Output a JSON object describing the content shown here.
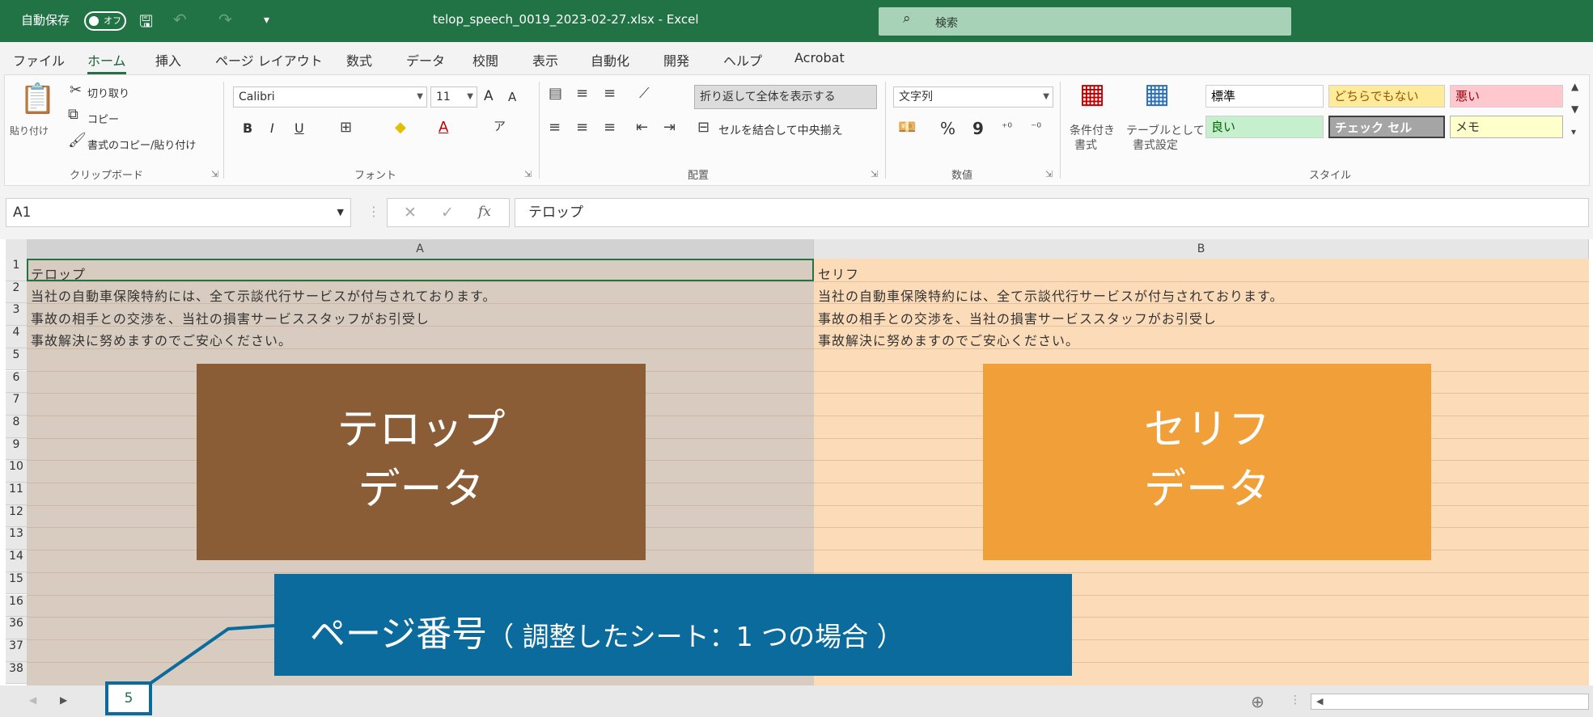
{
  "titlebar": {
    "autosave_label": "自動保存",
    "autosave_state": "オフ",
    "title": "telop_speech_0019_2023-02-27.xlsx  -  Excel",
    "search_placeholder": "検索"
  },
  "menu": {
    "tabs": [
      "ファイル",
      "ホーム",
      "挿入",
      "ページ レイアウト",
      "数式",
      "データ",
      "校閲",
      "表示",
      "自動化",
      "開発",
      "ヘルプ",
      "Acrobat"
    ],
    "active": "ホーム"
  },
  "ribbon": {
    "clipboard": {
      "paste": "貼り付け",
      "cut": "切り取り",
      "copy": "コピー",
      "format_painter": "書式のコピー/貼り付け",
      "label": "クリップボード"
    },
    "font": {
      "name": "Calibri",
      "size": "11",
      "grow": "A",
      "shrink": "A",
      "bold": "B",
      "italic": "I",
      "underline": "U",
      "font_color": "A",
      "label": "フォント"
    },
    "alignment": {
      "wrap_text": "折り返して全体を表示する",
      "merge_center": "セルを結合して中央揃え",
      "label": "配置"
    },
    "number": {
      "format": "文字列",
      "percent": "%",
      "comma": "9",
      "label": "数値"
    },
    "styles": {
      "conditional": "条件付き",
      "conditional2": "書式",
      "as_table": "テーブルとして",
      "as_table2": "書式設定",
      "label": "スタイル",
      "cells": {
        "normal": "標準",
        "neutral": "どちらでもない",
        "bad": "悪い",
        "good": "良い",
        "check": "チェック セル",
        "note": "メモ"
      }
    }
  },
  "formula_bar": {
    "name_box": "A1",
    "fx": "fx",
    "cancel": "✕",
    "enter": "✓",
    "content": "テロップ"
  },
  "sheet": {
    "columns": [
      "A",
      "B"
    ],
    "row_numbers": [
      "1",
      "2",
      "3",
      "4",
      "5",
      "6",
      "7",
      "8",
      "9",
      "10",
      "11",
      "12",
      "13",
      "14",
      "15",
      "16",
      "36",
      "37",
      "38"
    ],
    "rows": [
      {
        "a": "テロップ",
        "b": "セリフ"
      },
      {
        "a": "当社の自動車保険特約には、全て示談代行サービスが付与されております。",
        "b": "当社の自動車保険特約には、全て示談代行サービスが付与されております。"
      },
      {
        "a": "事故の相手との交渉を、当社の損害サービススタッフがお引受し",
        "b": "事故の相手との交渉を、当社の損害サービススタッフがお引受し"
      },
      {
        "a": "事故解決に努めますのでご安心ください。",
        "b": "事故解決に努めますのでご安心ください。"
      }
    ]
  },
  "overlays": {
    "telop_line1": "テロップ",
    "telop_line2": "データ",
    "serif_line1": "セリフ",
    "serif_line2": "データ",
    "callout_main": "ページ番号",
    "callout_sub": "（ 調整したシート：1 つの場合 ）"
  },
  "statusbar": {
    "prev": "◀",
    "next": "▶",
    "page_number": "5",
    "add_sheet": "⊕"
  },
  "colors": {
    "excel_green": "#217346",
    "telop_box": "#8a5d37",
    "serif_box": "#f19f38",
    "callout": "#0b6b9c"
  }
}
